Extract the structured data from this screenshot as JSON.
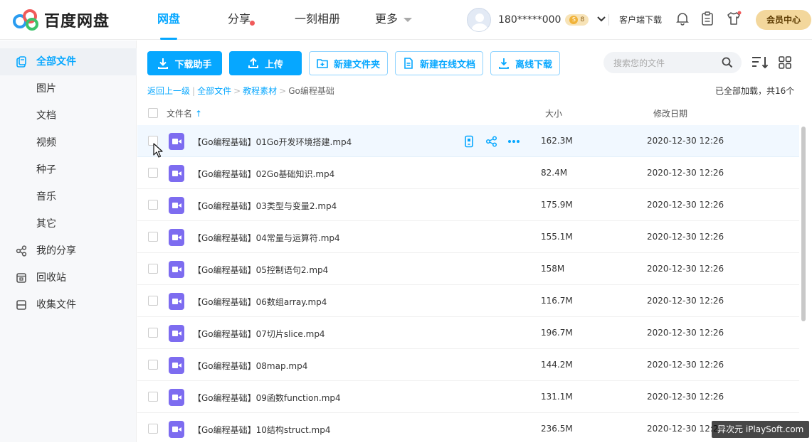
{
  "app": {
    "logo_text": "百度网盘"
  },
  "nav": {
    "items": [
      {
        "label": "网盘"
      },
      {
        "label": "分享"
      },
      {
        "label": "一刻相册"
      },
      {
        "label": "更多"
      }
    ]
  },
  "user": {
    "name": "180*****000",
    "badge_coin": "S",
    "badge_level": "8",
    "client_download": "客户端下载",
    "vip_center": "会员中心"
  },
  "sidebar": {
    "items": [
      {
        "label": "全部文件"
      },
      {
        "label": "图片"
      },
      {
        "label": "文档"
      },
      {
        "label": "视频"
      },
      {
        "label": "种子"
      },
      {
        "label": "音乐"
      },
      {
        "label": "其它"
      },
      {
        "label": "我的分享"
      },
      {
        "label": "回收站"
      },
      {
        "label": "收集文件"
      }
    ]
  },
  "toolbar": {
    "download_helper": "下载助手",
    "upload": "上传",
    "new_folder": "新建文件夹",
    "new_online_doc": "新建在线文档",
    "offline_download": "离线下载"
  },
  "search": {
    "placeholder": "搜索您的文件"
  },
  "breadcrumb": {
    "back": "返回上一级",
    "sep1": "|",
    "all_files": "全部文件",
    "sep2": ">",
    "folder": "教程素材",
    "sep3": ">",
    "current": "Go编程基础"
  },
  "load_status": "已全部加载，共16个",
  "columns": {
    "name": "文件名",
    "sort_arrow": "↑",
    "size": "大小",
    "date": "修改日期"
  },
  "files": [
    {
      "name": "【Go编程基础】01Go开发环境搭建.mp4",
      "size": "162.3M",
      "date": "2020-12-30 12:26"
    },
    {
      "name": "【Go编程基础】02Go基础知识.mp4",
      "size": "82.4M",
      "date": "2020-12-30 12:26"
    },
    {
      "name": "【Go编程基础】03类型与变量2.mp4",
      "size": "175.9M",
      "date": "2020-12-30 12:26"
    },
    {
      "name": "【Go编程基础】04常量与运算符.mp4",
      "size": "155.1M",
      "date": "2020-12-30 12:26"
    },
    {
      "name": "【Go编程基础】05控制语句2.mp4",
      "size": "158M",
      "date": "2020-12-30 12:26"
    },
    {
      "name": "【Go编程基础】06数组array.mp4",
      "size": "116.7M",
      "date": "2020-12-30 12:26"
    },
    {
      "name": "【Go编程基础】07切片slice.mp4",
      "size": "196.7M",
      "date": "2020-12-30 12:26"
    },
    {
      "name": "【Go编程基础】08map.mp4",
      "size": "144.2M",
      "date": "2020-12-30 12:26"
    },
    {
      "name": "【Go编程基础】09函数function.mp4",
      "size": "131.1M",
      "date": "2020-12-30 12:26"
    },
    {
      "name": "【Go编程基础】10结构struct.mp4",
      "size": "236.5M",
      "date": "2020-12-30 12:26"
    }
  ],
  "watermark": "异次元 iPlaySoft.com",
  "colors": {
    "accent": "#06a7ff",
    "video_icon": "#7d6cf0",
    "vip": "#f3d79c"
  }
}
